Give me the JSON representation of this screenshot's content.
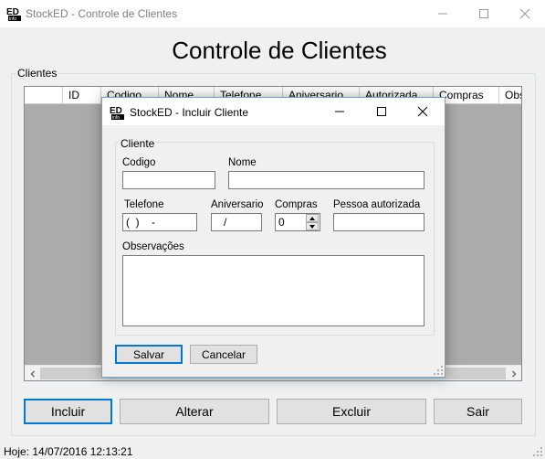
{
  "window": {
    "title": "StockED - Controle de Clientes",
    "app_icon": "stocked-logo-icon"
  },
  "page_title": "Controle de Clientes",
  "clientes_group": {
    "label": "Clientes",
    "columns": [
      "ID",
      "Codigo",
      "Nome",
      "Telefone",
      "Aniversario",
      "Autorizada",
      "Compras",
      "Obs"
    ]
  },
  "buttons": {
    "incluir": "Incluir",
    "alterar": "Alterar",
    "excluir": "Excluir",
    "sair": "Sair"
  },
  "status": {
    "text": "Hoje: 14/07/2016 12:13:21"
  },
  "dialog": {
    "title": "StockED - Incluir Cliente",
    "group_label": "Cliente",
    "fields": {
      "codigo": {
        "label": "Codigo",
        "value": ""
      },
      "nome": {
        "label": "Nome",
        "value": ""
      },
      "telefone": {
        "label": "Telefone",
        "value": "(  )    -"
      },
      "aniversario": {
        "label": "Aniversario",
        "value": "   /"
      },
      "compras": {
        "label": "Compras",
        "value": "0"
      },
      "pessoa_autorizada": {
        "label": "Pessoa autorizada",
        "value": ""
      },
      "observacoes": {
        "label": "Observações",
        "value": ""
      }
    },
    "salvar": "Salvar",
    "cancelar": "Cancelar"
  },
  "colors": {
    "accent": "#0078d7",
    "grid_background": "#ababab",
    "window_background": "#f0f0f0"
  }
}
